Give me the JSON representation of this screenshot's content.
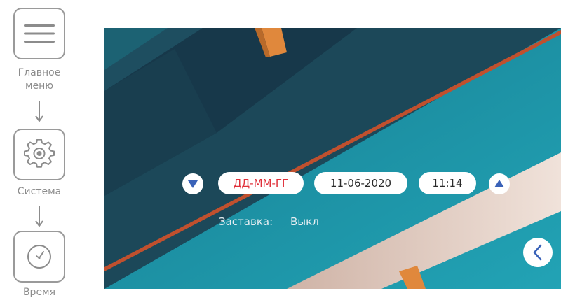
{
  "breadcrumb": {
    "items": [
      {
        "label": "Главное\nменю",
        "icon": "hamburger-menu-icon"
      },
      {
        "label": "Система",
        "icon": "gear-icon"
      },
      {
        "label": "Время",
        "icon": "clock-icon"
      }
    ]
  },
  "time_settings": {
    "date_format": "ДД-ММ-ГГ",
    "date": "11-06-2020",
    "time": "11:14",
    "decrease_icon": "triangle-down-icon",
    "increase_icon": "triangle-up-icon"
  },
  "screensaver": {
    "label": "Заставка:",
    "value": "Выкл"
  },
  "navigation": {
    "back_icon": "chevron-left-icon"
  },
  "colors": {
    "accent_blue": "#3a62b8",
    "format_red": "#e0303a",
    "screen_dark": "#1d4a5c",
    "screen_teal": "#1b95a8"
  }
}
